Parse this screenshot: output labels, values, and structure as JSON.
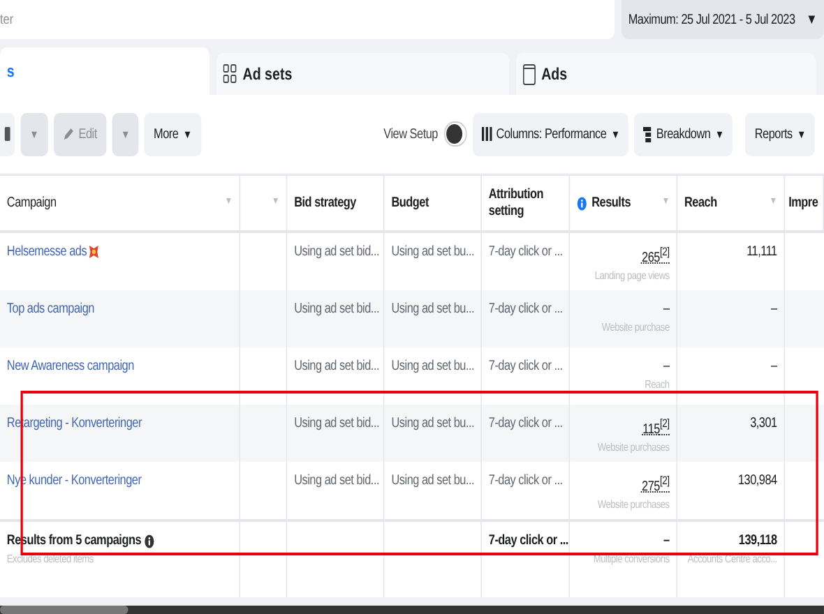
{
  "filter": {
    "placeholder": "ter"
  },
  "date_range": {
    "label": "Maximum: 25 Jul 2021 - 5 Jul 2023",
    "caret": "▼"
  },
  "tabs": [
    {
      "label": "s",
      "selected": true
    },
    {
      "label": "Ad sets",
      "selected": false
    },
    {
      "label": "Ads",
      "selected": false
    }
  ],
  "toolbar": {
    "edit": {
      "label": "Edit",
      "disabled": true
    },
    "more": "More",
    "caret": "▼",
    "view_setup": {
      "label": "View Setup",
      "on": false
    },
    "columns": "Columns: Performance",
    "breakdown": "Breakdown",
    "reports": "Reports"
  },
  "table": {
    "columns": [
      "Campaign",
      "",
      "Bid strategy",
      "Budget",
      "Attribution setting",
      "Results",
      "Reach",
      "Impre"
    ],
    "sort_caret": "▼",
    "rows": [
      {
        "campaign": "Helsemesse ads",
        "flag": true,
        "bid": "Using ad set bid...",
        "budget": "Using ad set bu...",
        "attribution": "7-day click or ...",
        "result": "265$^{[2]}$",
        "result_note": "Landing page views",
        "reach": "11,111"
      },
      {
        "campaign": "Top ads campaign",
        "flag": false,
        "bid": "Using ad set bid...",
        "budget": "Using ad set bu...",
        "attribution": "7-day click or ...",
        "result": "–",
        "result_note": "Website purchase",
        "reach": "–"
      },
      {
        "campaign": "New Awareness campaign",
        "flag": false,
        "bid": "Using ad set bid...",
        "budget": "Using ad set bu...",
        "attribution": "7-day click or ...",
        "result": "–",
        "result_note": "Reach",
        "reach": "–"
      },
      {
        "campaign": "Retargeting - Konverteringer",
        "flag": false,
        "bid": "Using ad set bid...",
        "budget": "Using ad set bu...",
        "attribution": "7-day click or ...",
        "result": "115$^{[2]}$",
        "result_note": "Website purchases",
        "reach": "3,301"
      },
      {
        "campaign": "Nye kunder - Konverteringer",
        "flag": false,
        "bid": "Using ad set bid...",
        "budget": "Using ad set bu...",
        "attribution": "7-day click or ...",
        "result": "275$^{[2]}$",
        "result_note": "Website purchases",
        "reach": "130,984"
      }
    ],
    "totals": {
      "label": "Results from 5 campaigns",
      "note": "Excludes deleted items",
      "attribution": "7-day click or ...",
      "result": "–",
      "result_note": "Multiple conversions",
      "reach": "139,118",
      "reach_note": "Accounts Centre acco..."
    }
  }
}
